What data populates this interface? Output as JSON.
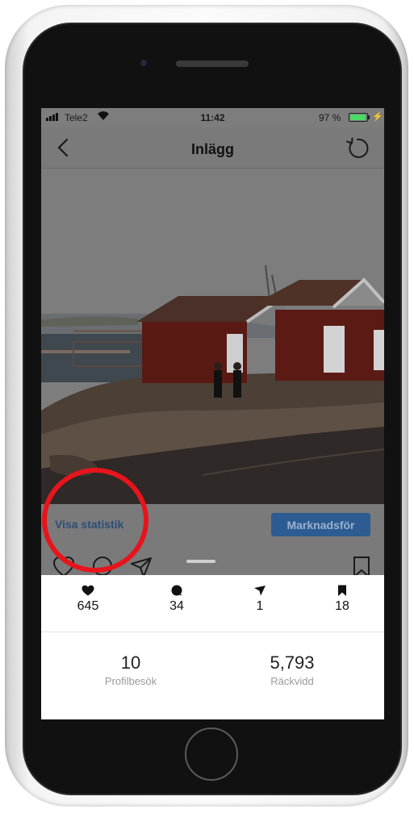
{
  "status_bar": {
    "carrier": "Tele2",
    "time": "11:42",
    "battery_percent": "97 %",
    "battery_level": 0.97
  },
  "nav": {
    "title": "Inlägg"
  },
  "post_actions": {
    "insights_link": "Visa statistik",
    "promote_button": "Marknadsför"
  },
  "stats": {
    "likes": "645",
    "comments": "34",
    "shares": "1",
    "saves": "18"
  },
  "summary": [
    {
      "value": "10",
      "label": "Profilbesök"
    },
    {
      "value": "5,793",
      "label": "Räckvidd"
    }
  ],
  "colors": {
    "highlight_circle": "#e8141c",
    "promote_button_bg": "#2c5c91",
    "insights_link": "#2c4e76",
    "overlay_dim": "#7a7a7a"
  }
}
